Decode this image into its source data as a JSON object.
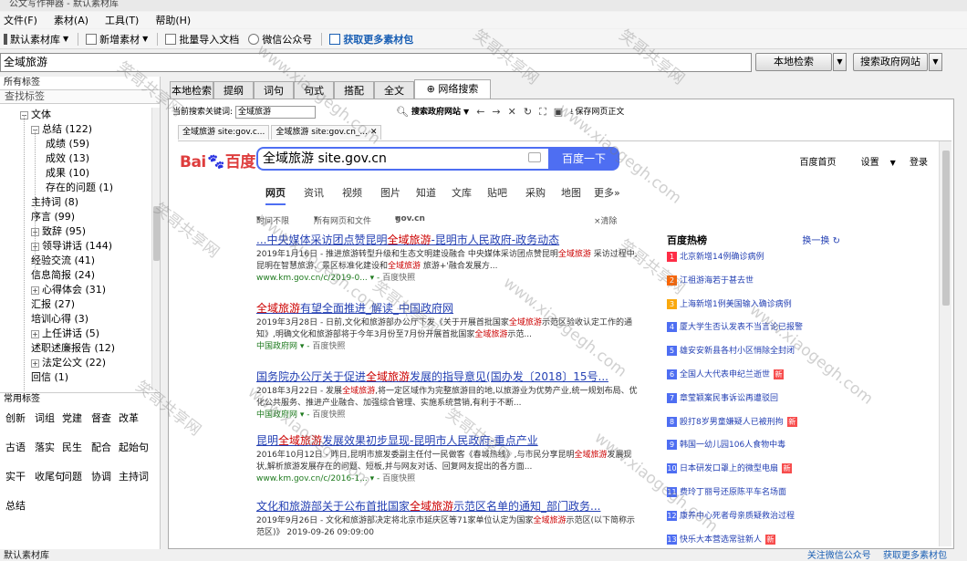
{
  "window": {
    "title": "公文写作神器 - 默认素材库"
  },
  "menu": [
    "文件(F)",
    "素材(A)",
    "工具(T)",
    "帮助(H)"
  ],
  "toolbar": {
    "default_lib": "默认素材库",
    "new_material": "新增素材",
    "batch_import": "批量导入文档",
    "wechat": "微信公众号",
    "get_more": "获取更多素材包"
  },
  "search": {
    "value": "全域旅游",
    "local_btn": "本地检索",
    "gov_btn": "搜索政府网站"
  },
  "left": {
    "all_tags": "所有标签",
    "find_tags": "查找标签",
    "tree": [
      {
        "label": "文体",
        "level": 0,
        "expander": "−"
      },
      {
        "label": "总结 (122)",
        "level": 1,
        "expander": "−"
      },
      {
        "label": "成绩 (59)",
        "level": 2,
        "expander": ""
      },
      {
        "label": "成效 (13)",
        "level": 2,
        "expander": ""
      },
      {
        "label": "成果 (10)",
        "level": 2,
        "expander": ""
      },
      {
        "label": "存在的问题 (1)",
        "level": 2,
        "expander": ""
      },
      {
        "label": "主持词 (8)",
        "level": 1,
        "expander": ""
      },
      {
        "label": "序言 (99)",
        "level": 1,
        "expander": ""
      },
      {
        "label": "致辞 (95)",
        "level": 1,
        "expander": "+"
      },
      {
        "label": "领导讲话 (144)",
        "level": 1,
        "expander": "+"
      },
      {
        "label": "经验交流 (41)",
        "level": 1,
        "expander": ""
      },
      {
        "label": "信息简报 (24)",
        "level": 1,
        "expander": ""
      },
      {
        "label": "心得体会 (31)",
        "level": 1,
        "expander": "+"
      },
      {
        "label": "汇报 (27)",
        "level": 1,
        "expander": ""
      },
      {
        "label": "培训心得 (3)",
        "level": 1,
        "expander": ""
      },
      {
        "label": "上任讲话 (5)",
        "level": 1,
        "expander": "+"
      },
      {
        "label": "述职述廉报告 (12)",
        "level": 1,
        "expander": ""
      },
      {
        "label": "法定公文 (22)",
        "level": 1,
        "expander": "+"
      },
      {
        "label": "回信 (1)",
        "level": 1,
        "expander": ""
      }
    ],
    "common_tags_title": "常用标签",
    "common_tags": [
      [
        "创新",
        "词组",
        "党建",
        "督查",
        "改革"
      ],
      [
        "古语",
        "落实",
        "民生",
        "配合",
        "起始句"
      ],
      [
        "实干",
        "收尾句",
        "问题",
        "协调",
        "主持词"
      ],
      [
        "总结"
      ]
    ]
  },
  "tabs": [
    "本地检索",
    "提纲",
    "词句",
    "句式",
    "搭配",
    "全文",
    "网络搜索"
  ],
  "browser": {
    "kw_label": "当前搜索关键词:",
    "kw_value": "全域旅游",
    "engine": "搜索政府网站",
    "save_label": "保存网页正文",
    "tabs": [
      "全域旅游 site:gov.c...",
      "全域旅游 site:gov.cn_..."
    ]
  },
  "baidu": {
    "logo_bai": "Bai",
    "logo_du": "百度",
    "query": "全域旅游 site.gov.cn",
    "btn": "百度一下",
    "top_links": [
      "百度首页",
      "设置",
      "登录"
    ],
    "tabs": [
      "网页",
      "资讯",
      "视频",
      "图片",
      "知道",
      "文库",
      "贴吧",
      "采购",
      "地图",
      "更多»"
    ],
    "filters": [
      "时间不限",
      "所有网页和文件",
      "gov.cn",
      "×清除"
    ],
    "results": [
      {
        "title_a": "...中央媒体采访团点赞昆明",
        "title_hl": "全域旅游",
        "title_b": "-昆明市人民政府-政务动态",
        "desc": "2019年1月16日 - 推进旅游转型升级和生态文明建设融合 中央媒体采访团点赞昆明全域旅游 采访过程中,昆明在智慧旅游、景区标准化建设和全域旅游 旅游+'融合发展方...",
        "url": "www.km.gov.cn/c/2019-0...",
        "snap": "百度快照"
      },
      {
        "title_a": "",
        "title_hl": "全域旅游",
        "title_b": "有望全面推进_解读_中国政府网",
        "desc": "2019年3月28日 - 日前,文化和旅游部办公厅下发《关于开展首批国家全域旅游示范区验收认定工作的通知》,明确文化和旅游部将于今年3月份至7月份开展首批国家全域旅游示范...",
        "url": "中国政府网",
        "snap": "百度快照"
      },
      {
        "title_a": "国务院办公厅关于促进",
        "title_hl": "全域旅游",
        "title_b": "发展的指导意见(国办发〔2018〕15号...",
        "desc": "2018年3月22日 - 发展全域旅游,将一定区域作为完整旅游目的地,以旅游业为优势产业,统一规划布局、优化公共服务、推进产业融合、加强综合管理、实施系统营销,有利于不断...",
        "url": "中国政府网",
        "snap": "百度快照"
      },
      {
        "title_a": "昆明",
        "title_hl": "全域旅游",
        "title_b": "发展效果初步显现-昆明市人民政府-重点产业",
        "desc": "2016年10月12日 - 昨日,昆明市旅发委副主任付一民做客《春城热线》,与市民分享昆明全域旅游发展现状,解析旅游发展存在的问题、短板,并与网友对话、回复网友提出的各方面...",
        "url": "www.km.gov.cn/c/2016-1...",
        "snap": "百度快照"
      },
      {
        "title_a": "文化和旅游部关于公布首批国家",
        "title_hl": "全域旅游",
        "title_b": "示范区名单的通知_部门政务...",
        "desc": "2019年9月26日 - 文化和旅游部决定将北京市延庆区等71家单位认定为国家全域旅游示范区(以下简称示范区)》 2019-09-26 09:09:00",
        "url": "",
        "snap": ""
      }
    ],
    "hot": {
      "title": "百度热榜",
      "refresh": "换一换",
      "items": [
        {
          "n": "1",
          "text": "北京新增14例确诊病例",
          "new": false,
          "color": "#fe2d46"
        },
        {
          "n": "2",
          "text": "江祖游海若于甚去世",
          "new": false,
          "color": "#f60"
        },
        {
          "n": "3",
          "text": "上海新增1例美国输入确诊病例",
          "new": false,
          "color": "#faa90e"
        },
        {
          "n": "4",
          "text": "厦大学生否认发表不当言论已报警",
          "new": false,
          "color": "#4e6ef2"
        },
        {
          "n": "5",
          "text": "雄安安新县各村小区悄除全封闭",
          "new": false,
          "color": "#4e6ef2"
        },
        {
          "n": "6",
          "text": "全国人大代表申纪兰逝世",
          "new": true,
          "color": "#4e6ef2"
        },
        {
          "n": "7",
          "text": "章莹颖案民事诉讼再遭驳回",
          "new": false,
          "color": "#4e6ef2"
        },
        {
          "n": "8",
          "text": "殴打8岁男童嫌疑人已被刑拘",
          "new": true,
          "color": "#4e6ef2"
        },
        {
          "n": "9",
          "text": "韩国一幼儿园106人食物中毒",
          "new": false,
          "color": "#4e6ef2"
        },
        {
          "n": "10",
          "text": "日本研发口罩上的微型电扇",
          "new": true,
          "color": "#4e6ef2"
        },
        {
          "n": "11",
          "text": "费玲丁丽号还原陈平车名场面",
          "new": false,
          "color": "#4e6ef2"
        },
        {
          "n": "12",
          "text": "康养中心死者母亲质疑救治过程",
          "new": false,
          "color": "#4e6ef2"
        },
        {
          "n": "13",
          "text": "快乐大本营选常驻新人",
          "new": true,
          "color": "#4e6ef2"
        }
      ],
      "new_label": "新"
    }
  },
  "status": {
    "left": "默认素材库",
    "links": [
      "关注微信公众号",
      "获取更多素材包"
    ]
  },
  "watermark": {
    "cn": "笑哥共享网",
    "url": "www.xiaogegh.com"
  }
}
